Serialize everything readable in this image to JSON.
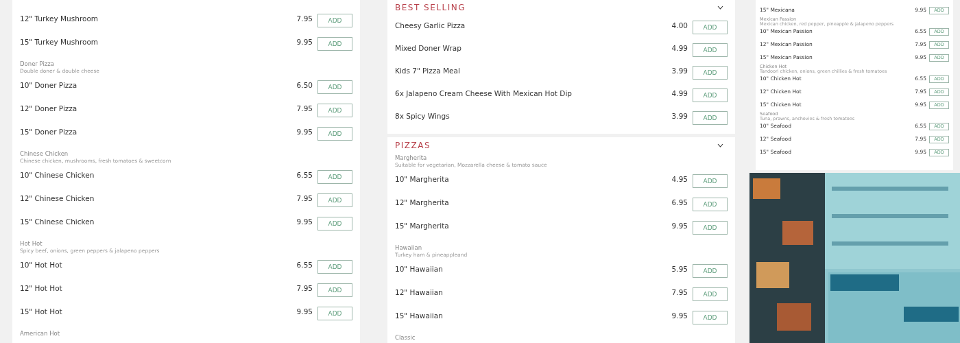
{
  "panels": [
    {
      "kind": "menu",
      "cards": [
        {
          "entries": [
            {
              "kind": "item",
              "name": "12\" Turkey Mushroom",
              "price": "7.95",
              "button": "ADD"
            },
            {
              "kind": "item",
              "name": "15\" Turkey Mushroom",
              "price": "9.95",
              "button": "ADD"
            },
            {
              "kind": "group",
              "name": "Doner Pizza",
              "description": "Double doner & double cheese"
            },
            {
              "kind": "item",
              "name": "10\" Doner Pizza",
              "price": "6.50",
              "button": "ADD"
            },
            {
              "kind": "item",
              "name": "12\" Doner Pizza",
              "price": "7.95",
              "button": "ADD"
            },
            {
              "kind": "item",
              "name": "15\" Doner Pizza",
              "price": "9.95",
              "button": "ADD"
            },
            {
              "kind": "group",
              "name": "Chinese Chicken",
              "description": "Chinese chicken, mushrooms, fresh tomatoes & sweetcorn"
            },
            {
              "kind": "item",
              "name": "10\" Chinese Chicken",
              "price": "6.55",
              "button": "ADD"
            },
            {
              "kind": "item",
              "name": "12\" Chinese Chicken",
              "price": "7.95",
              "button": "ADD"
            },
            {
              "kind": "item",
              "name": "15\" Chinese Chicken",
              "price": "9.95",
              "button": "ADD"
            },
            {
              "kind": "group",
              "name": "Hot Hot",
              "description": "Spicy beef, onions, green peppers & jalapeno peppers"
            },
            {
              "kind": "item",
              "name": "10\" Hot Hot",
              "price": "6.55",
              "button": "ADD"
            },
            {
              "kind": "item",
              "name": "12\" Hot Hot",
              "price": "7.95",
              "button": "ADD"
            },
            {
              "kind": "item",
              "name": "15\" Hot Hot",
              "price": "9.95",
              "button": "ADD"
            },
            {
              "kind": "group",
              "name": "American Hot"
            }
          ]
        }
      ]
    },
    {
      "kind": "menu",
      "cards": [
        {
          "title": "BEST SELLING",
          "entries": [
            {
              "kind": "item",
              "name": "Cheesy Garlic Pizza",
              "price": "4.00",
              "button": "ADD"
            },
            {
              "kind": "item",
              "name": "Mixed Doner Wrap",
              "price": "4.99",
              "button": "ADD"
            },
            {
              "kind": "item",
              "name": "Kids 7\" Pizza Meal",
              "price": "3.99",
              "button": "ADD"
            },
            {
              "kind": "item",
              "name": "6x Jalapeno Cream Cheese With Mexican Hot Dip",
              "price": "4.99",
              "button": "ADD"
            },
            {
              "kind": "item",
              "name": "8x Spicy Wings",
              "price": "3.99",
              "button": "ADD"
            }
          ]
        },
        {
          "title": "PIZZAS",
          "entries": [
            {
              "kind": "group",
              "name": "Margherita",
              "description": "Suitable for vegetarian, Mozzarella cheese & tomato sauce"
            },
            {
              "kind": "item",
              "name": "10\" Margherita",
              "price": "4.95",
              "button": "ADD"
            },
            {
              "kind": "item",
              "name": "12\" Margherita",
              "price": "6.95",
              "button": "ADD"
            },
            {
              "kind": "item",
              "name": "15\" Margherita",
              "price": "9.95",
              "button": "ADD"
            },
            {
              "kind": "group",
              "name": "Hawaiian",
              "description": "Turkey ham & pineappleand"
            },
            {
              "kind": "item",
              "name": "10\" Hawaiian",
              "price": "5.95",
              "button": "ADD"
            },
            {
              "kind": "item",
              "name": "12\" Hawaiian",
              "price": "7.95",
              "button": "ADD"
            },
            {
              "kind": "item",
              "name": "15\" Hawaiian",
              "price": "9.95",
              "button": "ADD"
            },
            {
              "kind": "group",
              "name": "Classic"
            }
          ]
        }
      ]
    },
    {
      "kind": "stack",
      "parts": [
        {
          "kind": "mini-menu",
          "cards": [
            {
              "entries": [
                {
                  "kind": "item",
                  "name": "15\" Mexicana",
                  "price": "9.95",
                  "button": "ADD"
                },
                {
                  "kind": "group",
                  "name": "Mexican Passion",
                  "description": "Mexican chicken, red pepper, pineapple & jalapeno peppers"
                },
                {
                  "kind": "item",
                  "name": "10\" Mexican Passion",
                  "price": "6.55",
                  "button": "ADD"
                },
                {
                  "kind": "item",
                  "name": "12\" Mexican Passion",
                  "price": "7.95",
                  "button": "ADD"
                },
                {
                  "kind": "item",
                  "name": "15\" Mexican Passion",
                  "price": "9.95",
                  "button": "ADD"
                },
                {
                  "kind": "group",
                  "name": "Chicken Hot",
                  "description": "Tandoori chicken, onions, green chillies & fresh tomatoes"
                },
                {
                  "kind": "item",
                  "name": "10\" Chicken Hot",
                  "price": "6.55",
                  "button": "ADD"
                },
                {
                  "kind": "item",
                  "name": "12\" Chicken Hot",
                  "price": "7.95",
                  "button": "ADD"
                },
                {
                  "kind": "item",
                  "name": "15\" Chicken Hot",
                  "price": "9.95",
                  "button": "ADD"
                },
                {
                  "kind": "group",
                  "name": "Seafood",
                  "description": "Tuna, prawns, anchovies & fresh tomatoes"
                },
                {
                  "kind": "item",
                  "name": "10\" Seafood",
                  "price": "6.55",
                  "button": "ADD"
                },
                {
                  "kind": "item",
                  "name": "12\" Seafood",
                  "price": "7.95",
                  "button": "ADD"
                },
                {
                  "kind": "item",
                  "name": "15\" Seafood",
                  "price": "9.95",
                  "button": "ADD"
                }
              ]
            }
          ]
        },
        {
          "kind": "picture"
        }
      ]
    }
  ]
}
